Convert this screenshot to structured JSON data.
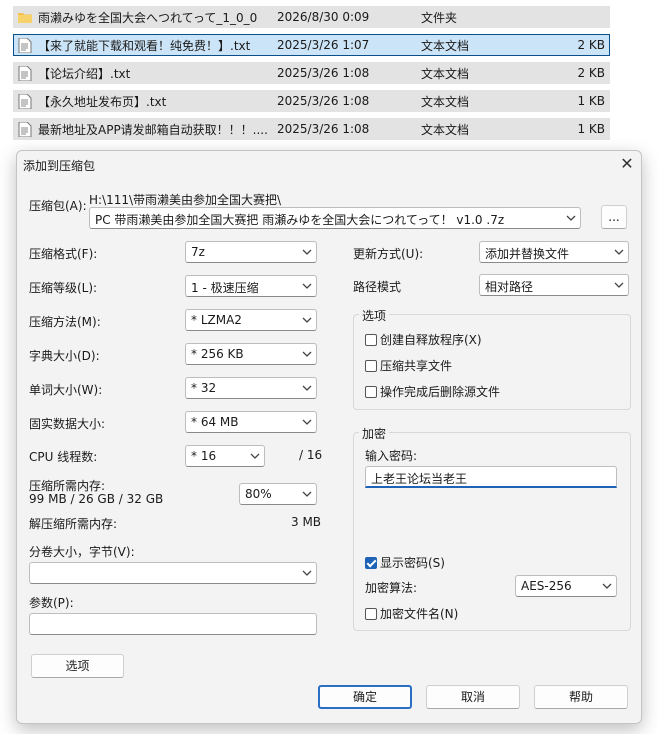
{
  "files": [
    {
      "name": "雨濑みゆを全国大会へつれてって_1_0_0",
      "date": "2026/8/30 0:09",
      "type": "文件夹",
      "size": "",
      "icon": "folder-icon"
    },
    {
      "name": "【来了就能下载和观看！纯免费！】.txt",
      "date": "2025/3/26 1:07",
      "type": "文本文档",
      "size": "2 KB",
      "icon": "text-file-icon"
    },
    {
      "name": "【论坛介绍】.txt",
      "date": "2025/3/26 1:08",
      "type": "文本文档",
      "size": "2 KB",
      "icon": "text-file-icon"
    },
    {
      "name": "【永久地址发布页】.txt",
      "date": "2025/3/26 1:08",
      "type": "文本文档",
      "size": "1 KB",
      "icon": "text-file-icon"
    },
    {
      "name": "最新地址及APP请发邮箱自动获取！！！....",
      "date": "2025/3/26 1:08",
      "type": "文本文档",
      "size": "1 KB",
      "icon": "text-file-icon"
    }
  ],
  "dialog": {
    "title": "添加到压缩包",
    "close_glyph": "✕",
    "archive_label": "压缩包(A):",
    "archive_path": "H:\\111\\带雨濑美由参加全国大赛把\\",
    "archive_name": "PC 带雨濑美由参加全国大赛把 雨瀬みゆを全国大会につれてって！ v1.0 .7z",
    "browse_label": "...",
    "format_label": "压缩格式(F):",
    "format_value": "7z",
    "level_label": "压缩等级(L):",
    "level_value": "1 - 极速压缩",
    "method_label": "压缩方法(M):",
    "method_value": "* LZMA2",
    "dict_label": "字典大小(D):",
    "dict_value": "* 256 KB",
    "word_label": "单词大小(W):",
    "word_value": "* 32",
    "solid_label": "固实数据大小:",
    "solid_value": "* 64 MB",
    "cpu_label": "CPU 线程数:",
    "cpu_value": "* 16",
    "cpu_total": "/ 16",
    "mem_label": "压缩所需内存:",
    "mem_detail": "99 MB / 26 GB / 32 GB",
    "mem_value": "80%",
    "decomp_label": "解压缩所需内存:",
    "decomp_value": "3 MB",
    "volume_label": "分卷大小，字节(V):",
    "volume_value": "",
    "params_label": "参数(P):",
    "params_value": "",
    "options_button": "选项",
    "update_label": "更新方式(U):",
    "update_value": "添加并替换文件",
    "pathmode_label": "路径模式",
    "pathmode_value": "相对路径",
    "options_group": "选项",
    "opt_sfx": "创建自释放程序(X)",
    "opt_shared": "压缩共享文件",
    "opt_delete": "操作完成后删除源文件",
    "encrypt_group": "加密",
    "pwd_label": "输入密码:",
    "pwd_value": "上老王论坛当老王",
    "show_pwd": "显示密码(S)",
    "enc_method_label": "加密算法:",
    "enc_method_value": "AES-256",
    "enc_names": "加密文件名(N)",
    "ok": "确定",
    "cancel": "取消",
    "help": "帮助"
  }
}
